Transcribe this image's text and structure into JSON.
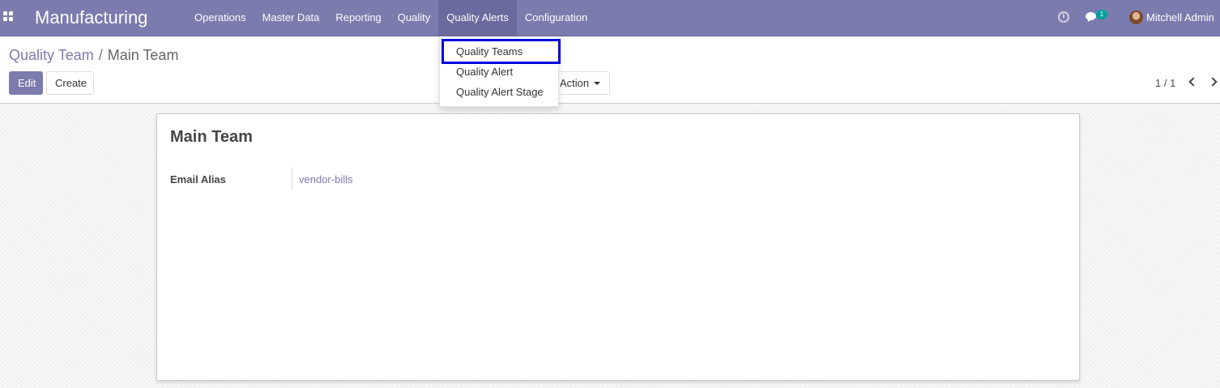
{
  "navbar": {
    "app_name": "Manufacturing",
    "menu": [
      "Operations",
      "Master Data",
      "Reporting",
      "Quality",
      "Quality Alerts",
      "Configuration"
    ],
    "active_menu": "Quality Alerts",
    "chat_badge": "1",
    "user_name": "Mitchell Admin"
  },
  "breadcrumb": {
    "parent": "Quality Team",
    "separator": "/",
    "current": "Main Team"
  },
  "buttons": {
    "edit": "Edit",
    "create": "Create",
    "action": "Action"
  },
  "pager": {
    "value": "1 / 1"
  },
  "dropdown": {
    "items": [
      "Quality Teams",
      "Quality Alert",
      "Quality Alert Stage"
    ],
    "highlighted": "Quality Teams"
  },
  "record": {
    "title": "Main Team",
    "fields": [
      {
        "label": "Email Alias",
        "value": "vendor-bills"
      }
    ]
  },
  "colors": {
    "brand": "#7c7bad",
    "highlight_outline": "#0000dd",
    "badge": "#00a09d"
  }
}
